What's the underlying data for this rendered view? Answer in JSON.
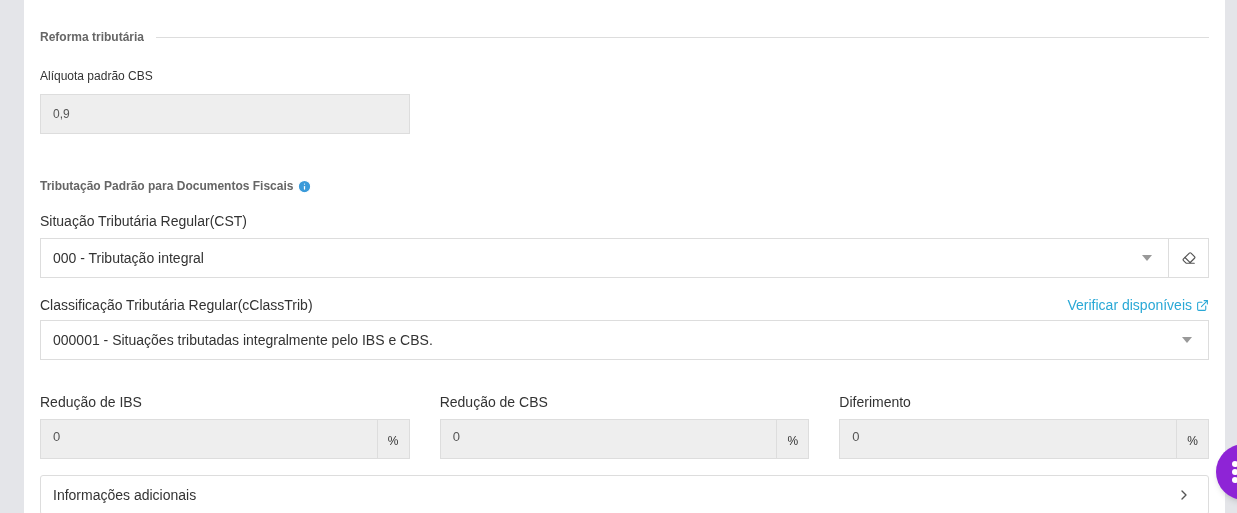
{
  "section_title": "Reforma tributária",
  "rate_field": {
    "label": "Alíquota padrão CBS",
    "value": "0,9",
    "disabled": true
  },
  "subsection_title": "Tributação Padrão para Documentos Fiscais",
  "cst_select": {
    "label": "Situação Tributária Regular(CST)",
    "value": "000 - Tributação integral"
  },
  "class_select": {
    "label": "Classificação Tributária Regular(cClassTrib)",
    "link": "Verificar disponíveis",
    "value": "000001 - Situações tributadas integralmente pelo IBS e CBS."
  },
  "percent_fields": [
    {
      "label": "Redução de IBS",
      "value": "0",
      "suffix": "%",
      "disabled": true
    },
    {
      "label": "Redução de CBS",
      "value": "0",
      "suffix": "%",
      "disabled": true
    },
    {
      "label": "Diferimento",
      "value": "0",
      "suffix": "%",
      "disabled": true
    }
  ],
  "accordion": {
    "label": "Informações adicionais",
    "expanded": false
  }
}
